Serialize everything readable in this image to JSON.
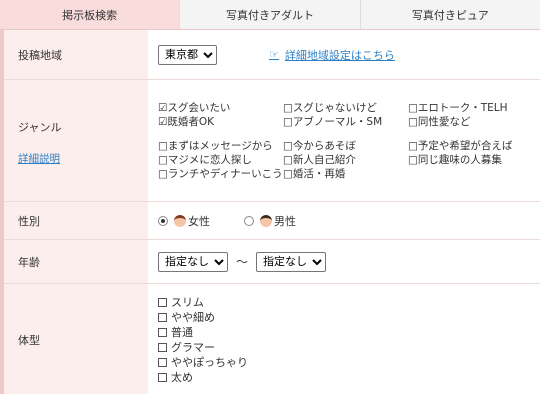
{
  "tabs": [
    {
      "label": "掲示板検索",
      "active": true
    },
    {
      "label": "写真付きアダルト",
      "active": false
    },
    {
      "label": "写真付きピュア",
      "active": false
    }
  ],
  "area": {
    "label": "投稿地域",
    "selected": "東京都",
    "detail_link": "詳細地域設定はこちら"
  },
  "genre": {
    "label": "ジャンル",
    "detail_link": "詳細説明",
    "group1": [
      "☑スグ会いたい",
      "□スグじゃないけど",
      "□エロトーク・TELH",
      "☑既婚者OK",
      "□アブノーマル・SM",
      "□同性愛など"
    ],
    "group2": [
      "□まずはメッセージから",
      "□今からあそぼ",
      "□予定や希望が合えば",
      "□マジメに恋人探し",
      "□新人自己紹介",
      "□同じ趣味の人募集",
      "□ランチやディナーいこう",
      "□婚活・再婚",
      ""
    ]
  },
  "sex": {
    "label": "性別",
    "female": "女性",
    "male": "男性"
  },
  "age": {
    "label": "年齢",
    "from": "指定なし",
    "tilde": "〜",
    "to": "指定なし"
  },
  "body": {
    "label": "体型",
    "options": [
      "スリム",
      "やや細め",
      "普通",
      "グラマー",
      "ややぽっちゃり",
      "太め"
    ]
  }
}
